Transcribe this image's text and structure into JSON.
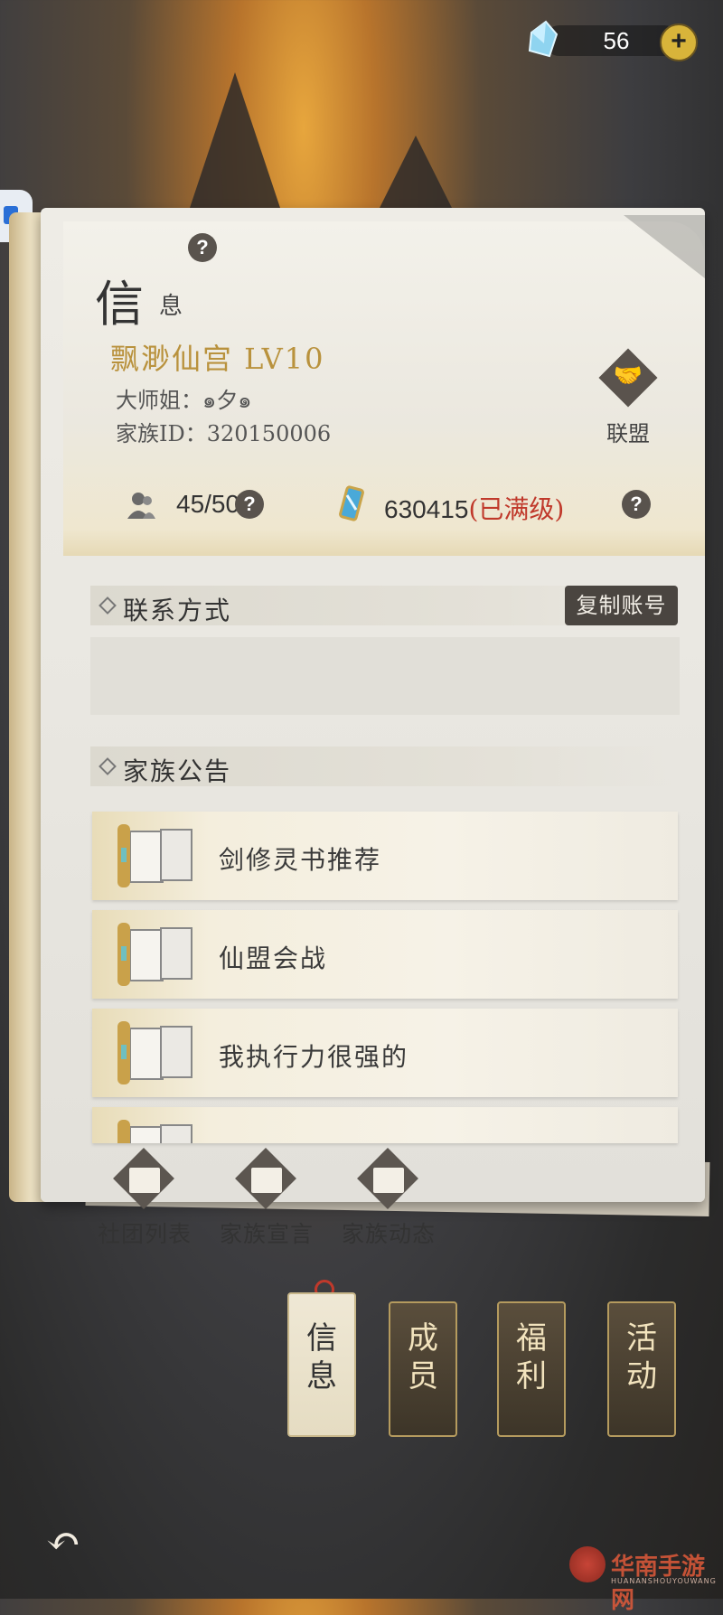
{
  "currency": {
    "count": "56",
    "plus": "+"
  },
  "header": {
    "title_big": "信",
    "title_small": "息",
    "help": "?",
    "clan_name": "飘渺仙宫 LV10",
    "leader": "大师姐：๑夕๑",
    "clan_id": "家族ID：320150006",
    "alliance_label": "联盟"
  },
  "stats": {
    "members": "45/50",
    "funds_value": "630415",
    "funds_status": "(已满级)"
  },
  "contact": {
    "section_title": "联系方式",
    "copy_button": "复制账号",
    "content": ""
  },
  "notices": {
    "section_title": "家族公告",
    "items": [
      {
        "label": "剑修灵书推荐"
      },
      {
        "label": "仙盟会战"
      },
      {
        "label": "我执行力很强的"
      },
      {
        "label": ""
      }
    ]
  },
  "bottom_buttons": [
    {
      "label": "社团列表",
      "icon": "clan-list-icon"
    },
    {
      "label": "家族宣言",
      "icon": "declaration-icon"
    },
    {
      "label": "家族动态",
      "icon": "activity-log-icon"
    }
  ],
  "tabs": [
    {
      "label": "信息",
      "active": true
    },
    {
      "label": "成员",
      "active": false
    },
    {
      "label": "福利",
      "active": false
    },
    {
      "label": "活动",
      "active": false
    }
  ],
  "back_icon": "back-arrow-icon",
  "watermark": {
    "text": "华南手游网",
    "sub": "HUANANSHOUYOUWANG"
  },
  "colors": {
    "accent_gold": "#b9923d",
    "maxed_red": "#c0392b",
    "dark_button": "#4a4540"
  }
}
